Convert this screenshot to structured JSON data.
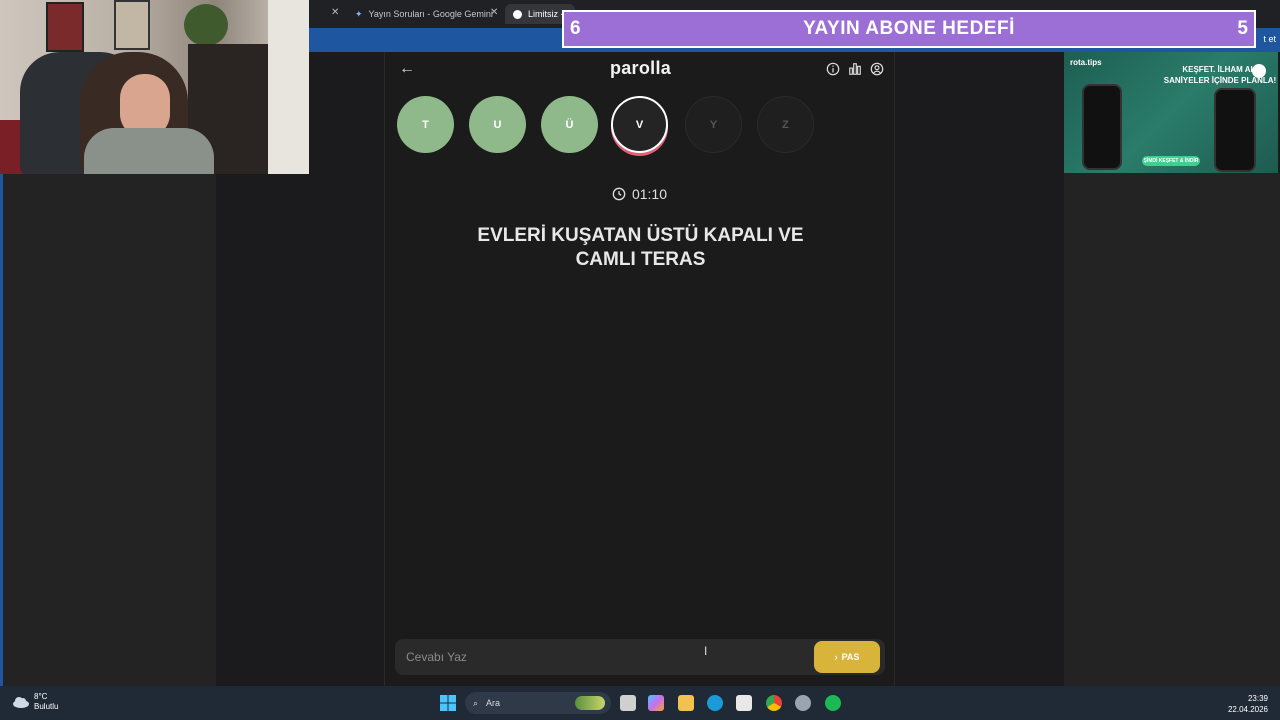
{
  "browser": {
    "tabs": [
      {
        "label": "Yayın Soruları - Google Gemini",
        "active": false
      },
      {
        "label": "Limitsiz -",
        "active": true
      }
    ],
    "addr_right_text": "t et"
  },
  "goal_banner": {
    "left_num": "6",
    "title": "YAYIN ABONE HEDEFİ",
    "right_num": "5",
    "color": "#9b6fd6"
  },
  "ad": {
    "brand": "rota.tips",
    "headline_1": "KEŞFET. İLHAM AL.",
    "headline_2": "SANİYELER İÇİNDE PLANLA!",
    "cta": "ŞİMDİ KEŞFET & İNDİR"
  },
  "app": {
    "logo": "parolla",
    "letters": [
      {
        "char": "T",
        "state": "done"
      },
      {
        "char": "U",
        "state": "done"
      },
      {
        "char": "Ü",
        "state": "done"
      },
      {
        "char": "V",
        "state": "current"
      },
      {
        "char": "Y",
        "state": "pending"
      },
      {
        "char": "Z",
        "state": "pending"
      }
    ],
    "timer": "01:10",
    "question_line_1": "EVLERİ KUŞATAN ÜSTÜ KAPALI VE",
    "question_line_2": "CAMLI TERAS",
    "answer_placeholder": "Cevabı Yaz",
    "pass_label": "PAS",
    "colors": {
      "done": "#8fb98a",
      "current_ring": "#e0607a",
      "pass": "#d9b43a"
    }
  },
  "taskbar": {
    "temp": "8°C",
    "condition": "Bulutlu",
    "search_label": "Ara",
    "time": "23:39",
    "date": "22.04.2026"
  }
}
